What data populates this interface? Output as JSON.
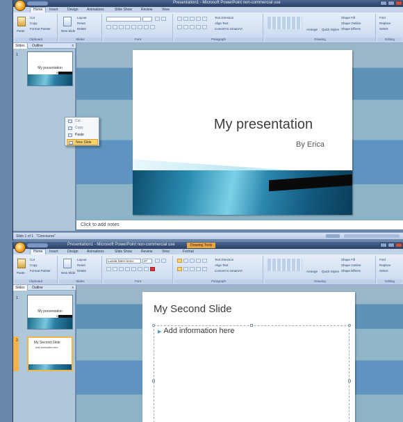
{
  "window1": {
    "title": "Presentation1 - Microsoft PowerPoint non-commercial use",
    "tabs": [
      "Home",
      "Insert",
      "Design",
      "Animations",
      "Slide Show",
      "Review",
      "View"
    ],
    "active_tab": "Home",
    "ribbon": {
      "clipboard": {
        "paste": "Paste",
        "cut": "Cut",
        "copy": "Copy",
        "format_painter": "Format Painter",
        "label": "Clipboard"
      },
      "slides": {
        "new_slide": "New Slide",
        "layout": "Layout",
        "reset": "Reset",
        "delete": "Delete",
        "label": "Slides"
      },
      "font": {
        "label": "Font"
      },
      "paragraph": {
        "text_direction": "Text Direction",
        "align_text": "Align Text",
        "convert_smartart": "Convert to SmartArt",
        "label": "Paragraph"
      },
      "drawing": {
        "arrange": "Arrange",
        "quick_styles": "Quick Styles",
        "shape_fill": "Shape Fill",
        "shape_outline": "Shape Outline",
        "shape_effects": "Shape Effects",
        "label": "Drawing"
      },
      "editing": {
        "find": "Find",
        "replace": "Replace",
        "select": "Select",
        "label": "Editing"
      }
    },
    "panel": {
      "tab_slides": "Slides",
      "tab_outline": "Outline",
      "close": "x"
    },
    "thumbnails": [
      {
        "num": "1",
        "title": "My presentation",
        "subtitle": "By Erica"
      }
    ],
    "context_menu": {
      "items": [
        "Cut",
        "Copy",
        "Paste",
        "New Slide"
      ],
      "highlighted": "New Slide"
    },
    "slide": {
      "title": "My presentation",
      "subtitle": "By Erica"
    },
    "notes_placeholder": "Click to add notes",
    "status": {
      "slide_info": "Slide 1 of 1",
      "theme": "\"Concourse\""
    }
  },
  "window2": {
    "title": "Presentation1 - Microsoft PowerPoint non-commercial use",
    "context_tab": "Drawing Tools",
    "tabs": [
      "Home",
      "Insert",
      "Design",
      "Animations",
      "Slide Show",
      "Review",
      "View",
      "Format"
    ],
    "active_tab": "Home",
    "ribbon": {
      "font_name": "Lucida Sans Unico",
      "font_size": "27",
      "clipboard": {
        "paste": "Paste",
        "cut": "Cut",
        "copy": "Copy",
        "format_painter": "Format Painter",
        "label": "Clipboard"
      },
      "slides": {
        "new_slide": "New Slide",
        "layout": "Layout",
        "reset": "Reset",
        "delete": "Delete",
        "label": "Slides"
      },
      "font": {
        "label": "Font"
      },
      "paragraph": {
        "text_direction": "Text Direction",
        "align_text": "Align Text",
        "convert_smartart": "Convert to SmartArt",
        "label": "Paragraph"
      },
      "drawing": {
        "arrange": "Arrange",
        "quick_styles": "Quick Styles",
        "shape_fill": "Shape Fill",
        "shape_outline": "Shape Outline",
        "shape_effects": "Shape Effects",
        "label": "Drawing"
      },
      "editing": {
        "find": "Find",
        "replace": "Replace",
        "select": "Select",
        "label": "Editing"
      }
    },
    "panel": {
      "tab_slides": "Slides",
      "tab_outline": "Outline",
      "close": "x"
    },
    "thumbnails": [
      {
        "num": "1",
        "title": "My presentation",
        "subtitle": "By Erica"
      },
      {
        "num": "2",
        "title": "My Second Slide",
        "subtitle": "Add information here"
      }
    ],
    "slide": {
      "title": "My Second Slide",
      "bullet": "Add information here"
    }
  }
}
